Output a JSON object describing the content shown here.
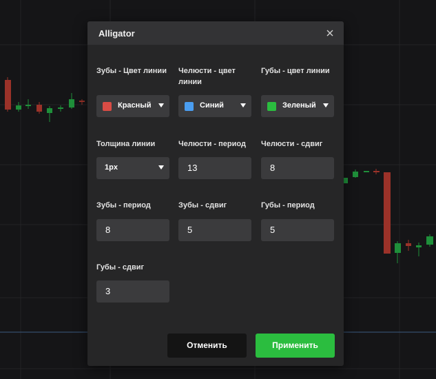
{
  "dialog": {
    "title": "Alligator",
    "close_icon": "close-icon"
  },
  "colors": {
    "red": "#d94c45",
    "blue": "#4a9df0",
    "green": "#2bbd3f",
    "apply_button": "#2bbd3f",
    "candle_up": "#1f8f3a",
    "candle_down": "#9b3229"
  },
  "fields": {
    "jaw_color_label": "Зубы - Цвет линии",
    "jaw_color_value": "Красный",
    "teeth_color_label": "Челюсти - цвет линии",
    "teeth_color_value": "Синий",
    "lips_color_label": "Губы - цвет линии",
    "lips_color_value": "Зеленый",
    "line_width_label": "Толщина линии",
    "line_width_value": "1px",
    "teeth_period_label": "Челюсти - период",
    "teeth_period_value": "13",
    "teeth_shift_label": "Челюсти - сдвиг",
    "teeth_shift_value": "8",
    "jaw_period_label": "Зубы - период",
    "jaw_period_value": "8",
    "jaw_shift_label": "Зубы - сдвиг",
    "jaw_shift_value": "5",
    "lips_period_label": "Губы - период",
    "lips_period_value": "5",
    "lips_shift_label": "Губы - сдвиг",
    "lips_shift_value": "3"
  },
  "buttons": {
    "cancel": "Отменить",
    "apply": "Применить"
  }
}
